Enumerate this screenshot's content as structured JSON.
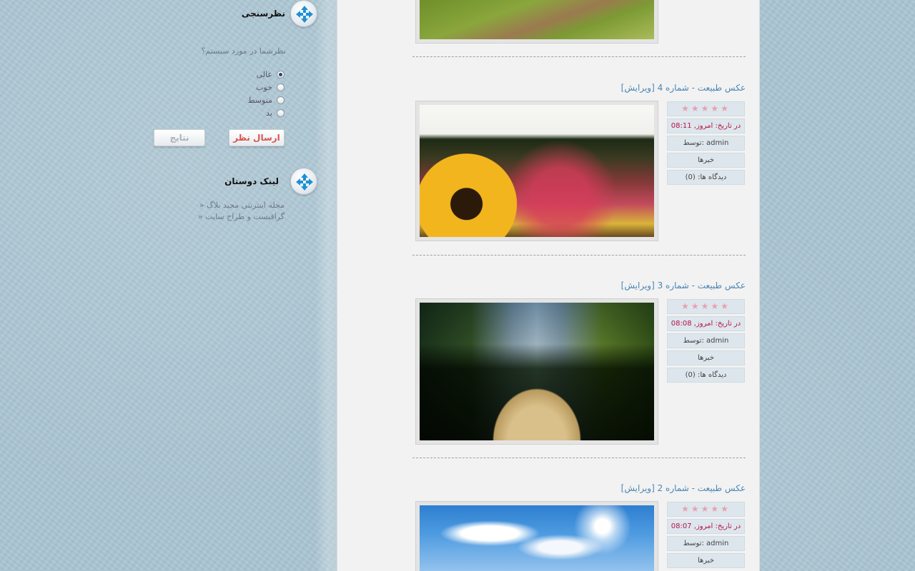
{
  "sidebar": {
    "poll": {
      "title": "نظرسنجی",
      "question": "نظرشما در مورد سیستم؟",
      "options": [
        {
          "label": "عالی",
          "checked": true
        },
        {
          "label": "خوب",
          "checked": false
        },
        {
          "label": "متوسط",
          "checked": false
        },
        {
          "label": "بد",
          "checked": false
        }
      ],
      "send_label": "ارسال نظر",
      "results_label": "نتایج"
    },
    "friends": {
      "title": "لینک دوستان",
      "links": [
        "» مجله اینترنتی مجید بلاگ",
        "» گرافیست و طراح سایت"
      ]
    }
  },
  "posts": [
    {
      "title": "عکس طبیعت - شماره 4 [ویرایش]",
      "stars": "★★★★★",
      "date": "در تاریخ: امروز, 08:11",
      "author": "توسط: admin",
      "category": "خبرها",
      "comments": "دیدگاه ها: (0)",
      "photo_icon": "flower-field-photo"
    },
    {
      "title": "عکس طبیعت - شماره 3 [ویرایش]",
      "stars": "★★★★★",
      "date": "در تاریخ: امروز, 08:08",
      "author": "توسط: admin",
      "category": "خبرها",
      "comments": "دیدگاه ها: (0)",
      "photo_icon": "canoe-lake-photo"
    },
    {
      "title": "عکس طبیعت - شماره 2 [ویرایش]",
      "stars": "★★★★★",
      "date": "در تاریخ: امروز, 08:07",
      "author": "توسط: admin",
      "category": "خبرها",
      "comments": "",
      "photo_icon": "sky-city-photo"
    }
  ],
  "colors": {
    "page_bg": "#a8c4d1",
    "content_bg": "#f2f2f2",
    "title_link": "#4a86b4",
    "date_text": "#b4124a",
    "info_bg": "#dde6ec",
    "stars": "#e8a0b1"
  }
}
